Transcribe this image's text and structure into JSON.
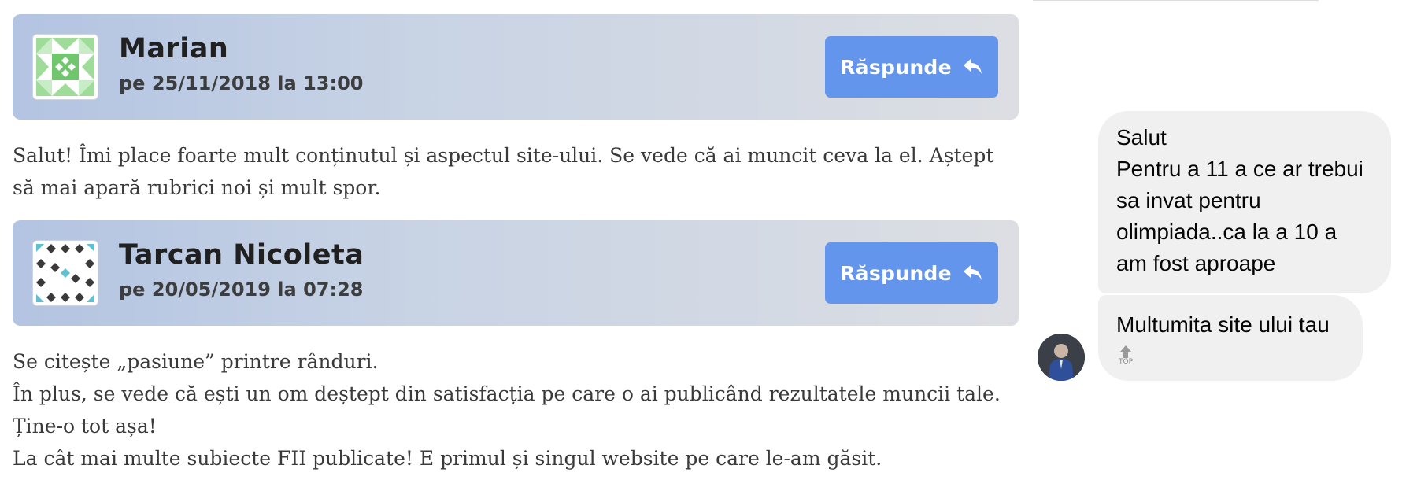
{
  "comments": [
    {
      "author": "Marian",
      "date": "pe 25/11/2018 la 13:00",
      "reply_label": "Răspunde",
      "body": [
        "Salut! Îmi place foarte mult conținutul și aspectul site-ului. Se vede că ai muncit ceva la el. Aștept să mai apară rubrici noi și mult spor."
      ]
    },
    {
      "author": "Tarcan Nicoleta",
      "date": "pe 20/05/2019 la 07:28",
      "reply_label": "Răspunde",
      "body": [
        "Se citește „pasiune” printre rânduri.",
        "În plus, se vede că ești un om deștept din satisfacția pe care o ai publicând rezultatele muncii tale.",
        "Ține-o tot așa!",
        "La cât mai multe subiecte FII publicate! E primul și singul website pe care le-am găsit."
      ]
    }
  ],
  "chat": {
    "messages": [
      {
        "lines": [
          "Salut",
          "Pentru a 11 a ce ar trebui",
          "sa invat pentru",
          "olimpiada..ca la a 10 a",
          "am fost aproape"
        ]
      },
      {
        "lines": [
          "Multumita site ului tau"
        ]
      }
    ],
    "top_icon_label": "TOP"
  },
  "colors": {
    "reply_button": "#6395ed",
    "header_gradient_start": "#b3c4e2",
    "header_gradient_end": "#dcdee3",
    "bubble": "#f0f0f0"
  },
  "icons": {
    "reply": "reply-arrow-icon",
    "avatar_1": "identicon-green-icon",
    "avatar_2": "identicon-teal-icon",
    "top": "top-arrow-icon"
  }
}
